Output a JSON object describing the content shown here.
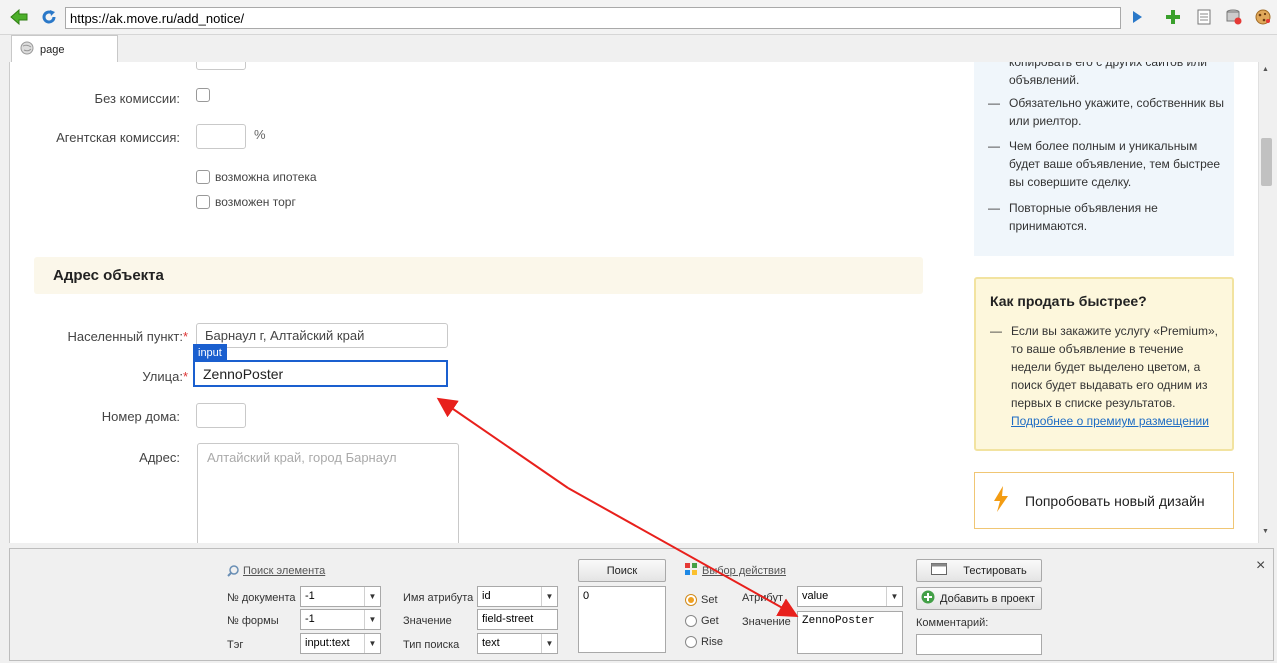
{
  "browser": {
    "url": "https://ak.move.ru/add_notice/",
    "tab_label": "page"
  },
  "form": {
    "no_commission_label": "Без комиссии:",
    "agent_commission_label": "Агентская комиссия:",
    "percent_unit": "%",
    "mortgage_label": "возможна ипотека",
    "bargain_label": "возможен торг",
    "address_section_title": "Адрес объекта",
    "locality_label": "Населенный пункт:",
    "locality_value": "Барнаул г, Алтайский край",
    "required_mark": "*",
    "input_badge": "input",
    "street_label": "Улица:",
    "street_value": "ZennoPoster",
    "house_label": "Номер дома:",
    "address_label": "Адрес:",
    "address_placeholder": "Алтайский край, город Барнаул"
  },
  "tips": {
    "partial": "копировать его с других сайтов или объявлений.",
    "dash": "—",
    "items": [
      "Обязательно укажите, собственник вы или риелтор.",
      "Чем более полным и уникальным будет ваше объявление, тем быстрее вы совершите сделку.",
      "Повторные объявления не принимаются."
    ]
  },
  "faster": {
    "title": "Как продать быстрее?",
    "text": "Если вы закажите услугу «Premium», то ваше объявление в течение недели будет выделено цветом, а поиск будет выдавать его одним из первых в списке результатов.",
    "link": "Подробнее о премиум размещении"
  },
  "new_design": {
    "label": "Попробовать новый дизайн"
  },
  "inspector": {
    "search_header": "Поиск элемента",
    "doc_label": "№ документа",
    "doc_value": "-1",
    "form_label": "№ формы",
    "form_value": "-1",
    "tag_label": "Тэг",
    "tag_value": "input:text",
    "attr_name_label": "Имя атрибута",
    "attr_name_value": "id",
    "value_label": "Значение",
    "value_value": "field-street",
    "search_type_label": "Тип поиска",
    "search_type_value": "text",
    "search_button": "Поиск",
    "results_value": "0",
    "action_header": "Выбор действия",
    "set_label": "Set",
    "get_label": "Get",
    "rise_label": "Rise",
    "attribute_label": "Атрибут",
    "attribute_value": "value",
    "action_value_label": "Значение",
    "action_value": "ZennoPoster",
    "test_button": "Тестировать",
    "add_button": "Добавить в проект",
    "comment_label": "Комментарий:",
    "close_glyph": "×"
  },
  "colors": {
    "accent_blue": "#2b6fd6",
    "badge_blue": "#1a5fcf",
    "arrow_red": "#e8201c",
    "required_red": "#d33333",
    "premium_bg": "#fdf7dc",
    "tips_bg": "#f0f6fb"
  }
}
